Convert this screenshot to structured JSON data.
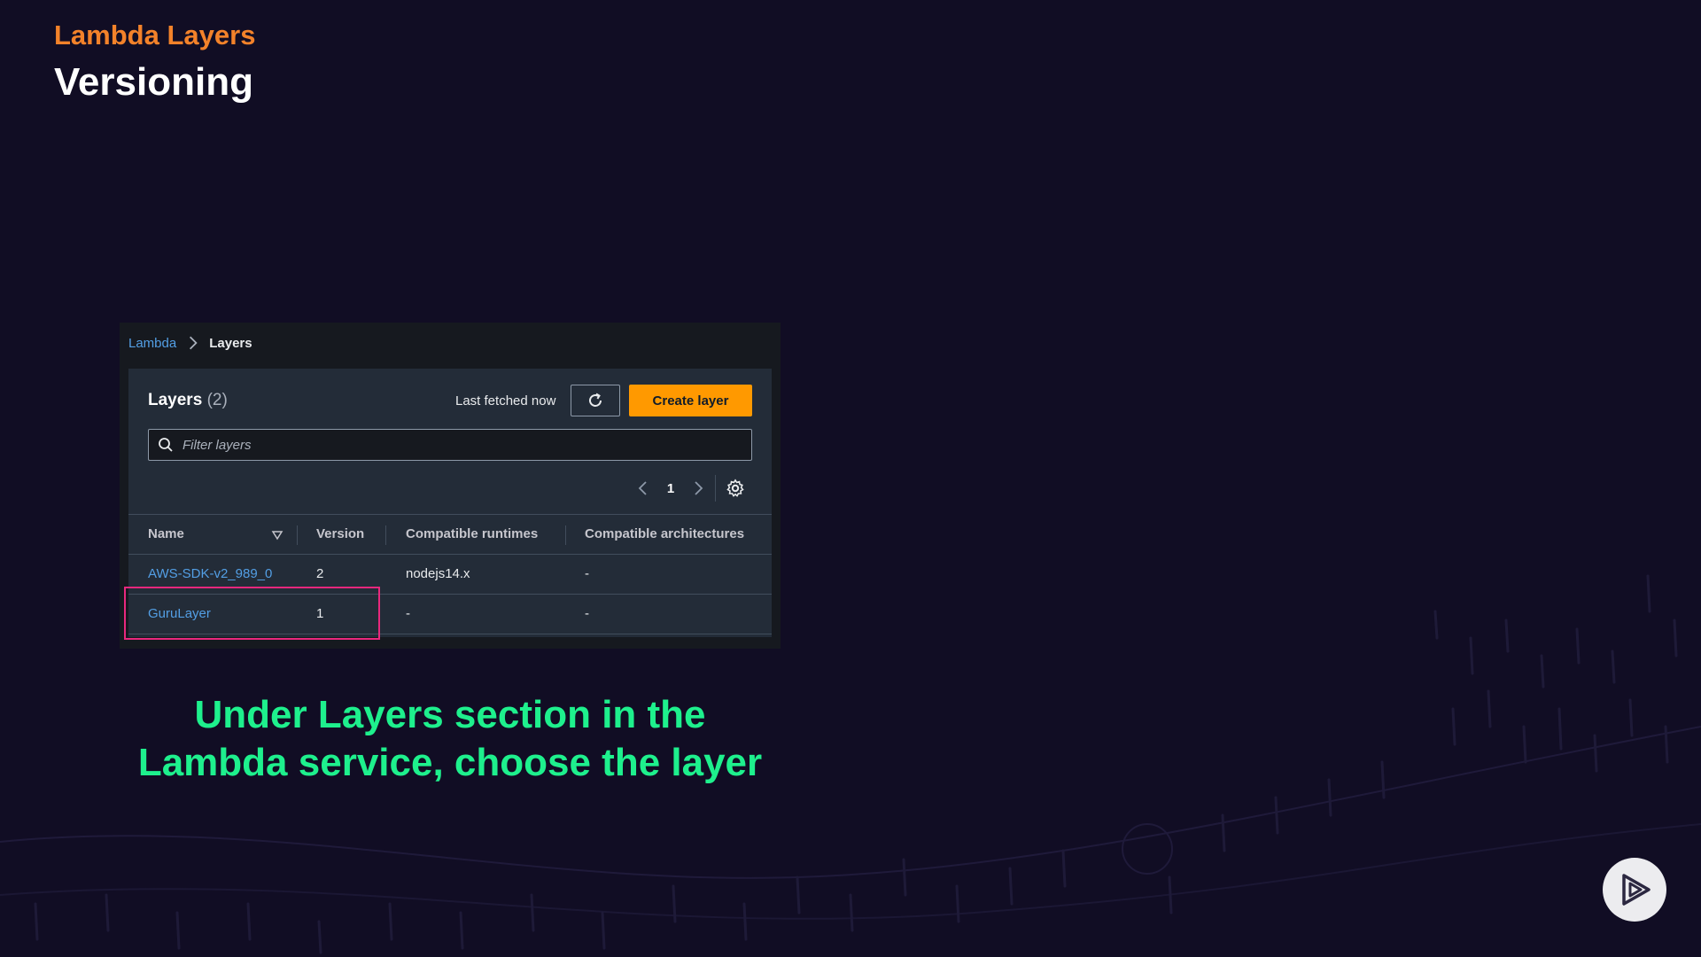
{
  "slide": {
    "kicker": "Lambda Layers",
    "title": "Versioning",
    "caption_line1": "Under Layers section in the",
    "caption_line2": "Lambda service, choose the layer"
  },
  "console": {
    "breadcrumb": {
      "root": "Lambda",
      "current": "Layers"
    },
    "panel": {
      "title": "Layers",
      "count": "(2)",
      "last_fetched": "Last fetched now",
      "create_label": "Create layer",
      "filter_placeholder": "Filter layers",
      "page_number": "1"
    },
    "columns": {
      "name": "Name",
      "version": "Version",
      "runtimes": "Compatible runtimes",
      "architectures": "Compatible architectures"
    },
    "rows": [
      {
        "name": "AWS-SDK-v2_989_0",
        "version": "2",
        "runtimes": "nodejs14.x",
        "architectures": "-"
      },
      {
        "name": "GuruLayer",
        "version": "1",
        "runtimes": "-",
        "architectures": "-"
      }
    ]
  },
  "colors": {
    "background": "#110d24",
    "kicker": "#f3822a",
    "caption": "#1ef08d",
    "highlight": "#e8287d",
    "create_button": "#ff9900",
    "link": "#539fe5"
  },
  "icons": {
    "breadcrumb_separator": "chevron-right-icon",
    "refresh": "refresh-icon",
    "search": "search-icon",
    "prev": "chevron-left-icon",
    "next": "chevron-right-icon",
    "settings": "gear-icon",
    "sort": "sort-down-icon",
    "brand": "play-logo-icon"
  }
}
